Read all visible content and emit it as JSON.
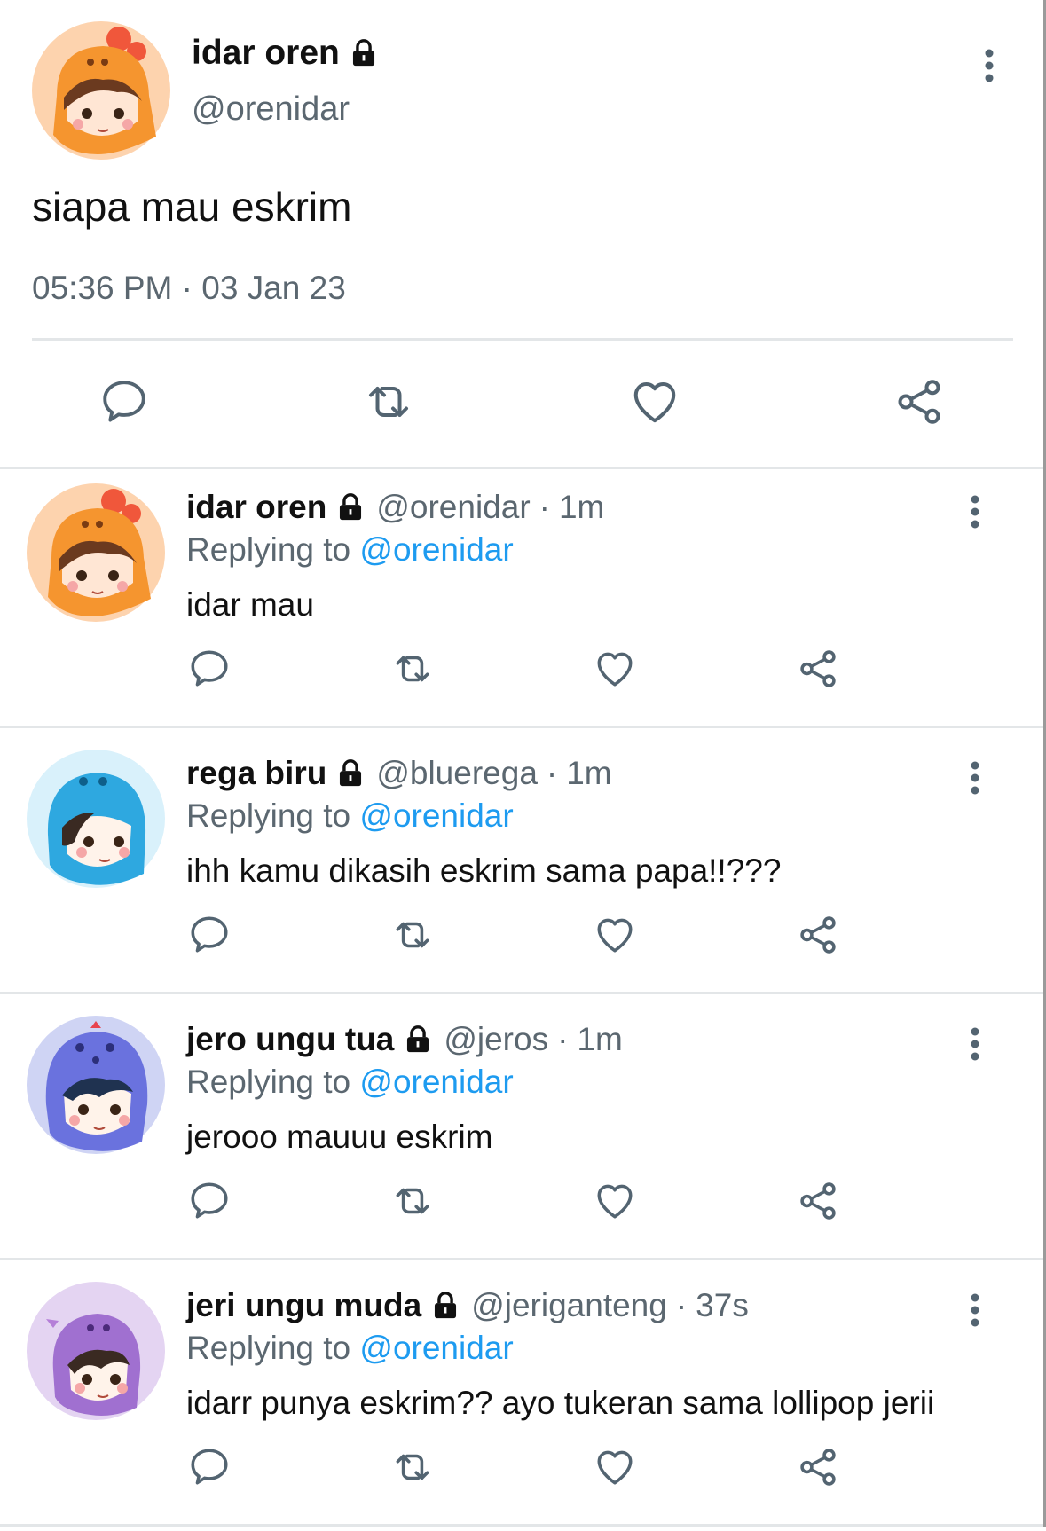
{
  "main_tweet": {
    "name": "idar oren",
    "handle": "@orenidar",
    "text": "siapa mau eskrim",
    "timestamp": "05:36 PM · 03 Jan 23",
    "avatar": "orange-dino-avatar",
    "icons": [
      "lock-icon",
      "more-icon",
      "reply-icon",
      "retweet-icon",
      "like-icon",
      "share-icon"
    ]
  },
  "replies": [
    {
      "name": "idar oren",
      "handle": "@orenidar",
      "age": "1m",
      "replying_label": "Replying to",
      "replying_to": "@orenidar",
      "text": "idar mau",
      "avatar": "orange-dino-avatar"
    },
    {
      "name": "rega biru",
      "handle": "@bluerega",
      "age": "1m",
      "replying_label": "Replying to",
      "replying_to": "@orenidar",
      "text": "ihh kamu dikasih eskrim sama papa!!???",
      "avatar": "blue-dino-avatar"
    },
    {
      "name": "jero ungu tua",
      "handle": "@jeros",
      "age": "1m",
      "replying_label": "Replying to",
      "replying_to": "@orenidar",
      "text": "jerooo mauuu eskrim",
      "avatar": "dark-purple-dino-avatar"
    },
    {
      "name": "jeri ungu muda",
      "handle": "@jeriganteng",
      "age": "37s",
      "replying_label": "Replying to",
      "replying_to": "@orenidar",
      "text": "idarr punya eskrim?? ayo tukeran sama lollipop jerii",
      "avatar": "light-purple-dino-avatar"
    }
  ],
  "separator_dot": "·",
  "colors": {
    "mention": "#1d9bf0",
    "secondary_text": "#5b6770",
    "icon": "#536471",
    "divider": "#e3e6e8"
  }
}
